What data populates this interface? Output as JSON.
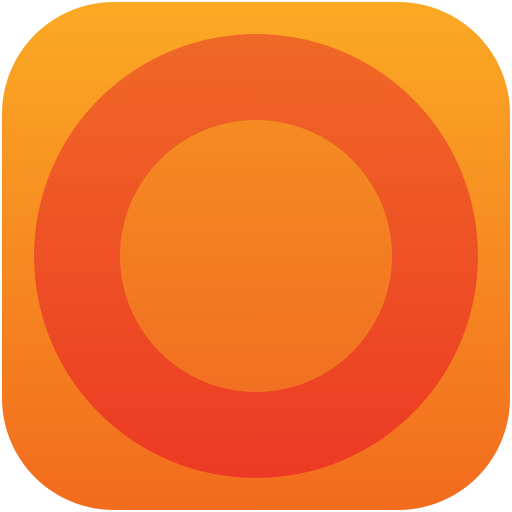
{
  "app_icon": {
    "icon_name": "ring-icon",
    "colors": {
      "tile_top": "#FBA924",
      "tile_bottom": "#F26B1E",
      "ring_top": "#F06826",
      "ring_bottom": "#EC3A24",
      "center_top": "#F48B22",
      "center_bottom": "#F26F22"
    }
  }
}
